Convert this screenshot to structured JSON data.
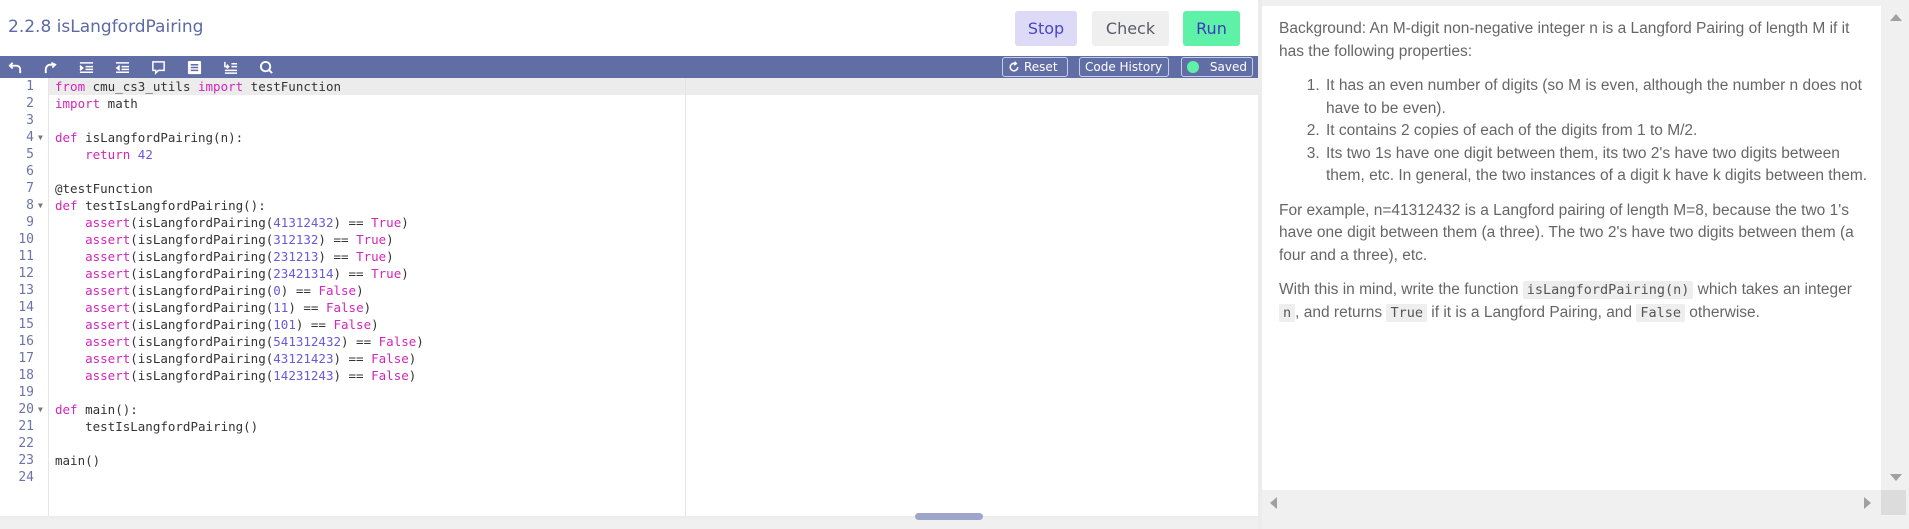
{
  "header": {
    "title": "2.2.8 isLangfordPairing",
    "buttons": {
      "stop": "Stop",
      "check": "Check",
      "run": "Run"
    }
  },
  "toolbar": {
    "icons": [
      "undo-icon",
      "redo-icon",
      "indent-icon",
      "outdent-icon",
      "comment-icon",
      "format-icon",
      "fold-icon",
      "search-icon"
    ],
    "reset_label": "Reset",
    "history_label": "Code History",
    "saved_label": "Saved"
  },
  "editor": {
    "lines": [
      {
        "n": "1",
        "fold": false,
        "tokens": [
          [
            "kw",
            "from"
          ],
          [
            "t",
            " cmu_cs3_utils "
          ],
          [
            "kw",
            "import"
          ],
          [
            "t",
            " testFunction"
          ]
        ]
      },
      {
        "n": "2",
        "fold": false,
        "tokens": [
          [
            "kw",
            "import"
          ],
          [
            "t",
            " math"
          ]
        ]
      },
      {
        "n": "3",
        "fold": false,
        "tokens": []
      },
      {
        "n": "4",
        "fold": true,
        "tokens": [
          [
            "kw",
            "def"
          ],
          [
            "t",
            " isLangfordPairing(n):"
          ]
        ]
      },
      {
        "n": "5",
        "fold": false,
        "tokens": [
          [
            "t",
            "    "
          ],
          [
            "kw",
            "return"
          ],
          [
            "t",
            " "
          ],
          [
            "num",
            "42"
          ]
        ]
      },
      {
        "n": "6",
        "fold": false,
        "tokens": []
      },
      {
        "n": "7",
        "fold": false,
        "tokens": [
          [
            "t",
            "@testFunction"
          ]
        ]
      },
      {
        "n": "8",
        "fold": true,
        "tokens": [
          [
            "kw",
            "def"
          ],
          [
            "t",
            " testIsLangfordPairing():"
          ]
        ]
      },
      {
        "n": "9",
        "fold": false,
        "tokens": [
          [
            "t",
            "    "
          ],
          [
            "kw",
            "assert"
          ],
          [
            "t",
            "(isLangfordPairing("
          ],
          [
            "num",
            "41312432"
          ],
          [
            "t",
            ") == "
          ],
          [
            "bool",
            "True"
          ],
          [
            "t",
            ")"
          ]
        ]
      },
      {
        "n": "10",
        "fold": false,
        "tokens": [
          [
            "t",
            "    "
          ],
          [
            "kw",
            "assert"
          ],
          [
            "t",
            "(isLangfordPairing("
          ],
          [
            "num",
            "312132"
          ],
          [
            "t",
            ") == "
          ],
          [
            "bool",
            "True"
          ],
          [
            "t",
            ")"
          ]
        ]
      },
      {
        "n": "11",
        "fold": false,
        "tokens": [
          [
            "t",
            "    "
          ],
          [
            "kw",
            "assert"
          ],
          [
            "t",
            "(isLangfordPairing("
          ],
          [
            "num",
            "231213"
          ],
          [
            "t",
            ") == "
          ],
          [
            "bool",
            "True"
          ],
          [
            "t",
            ")"
          ]
        ]
      },
      {
        "n": "12",
        "fold": false,
        "tokens": [
          [
            "t",
            "    "
          ],
          [
            "kw",
            "assert"
          ],
          [
            "t",
            "(isLangfordPairing("
          ],
          [
            "num",
            "23421314"
          ],
          [
            "t",
            ") == "
          ],
          [
            "bool",
            "True"
          ],
          [
            "t",
            ")"
          ]
        ]
      },
      {
        "n": "13",
        "fold": false,
        "tokens": [
          [
            "t",
            "    "
          ],
          [
            "kw",
            "assert"
          ],
          [
            "t",
            "(isLangfordPairing("
          ],
          [
            "num",
            "0"
          ],
          [
            "t",
            ") == "
          ],
          [
            "bool",
            "False"
          ],
          [
            "t",
            ")"
          ]
        ]
      },
      {
        "n": "14",
        "fold": false,
        "tokens": [
          [
            "t",
            "    "
          ],
          [
            "kw",
            "assert"
          ],
          [
            "t",
            "(isLangfordPairing("
          ],
          [
            "num",
            "11"
          ],
          [
            "t",
            ") == "
          ],
          [
            "bool",
            "False"
          ],
          [
            "t",
            ")"
          ]
        ]
      },
      {
        "n": "15",
        "fold": false,
        "tokens": [
          [
            "t",
            "    "
          ],
          [
            "kw",
            "assert"
          ],
          [
            "t",
            "(isLangfordPairing("
          ],
          [
            "num",
            "101"
          ],
          [
            "t",
            ") == "
          ],
          [
            "bool",
            "False"
          ],
          [
            "t",
            ")"
          ]
        ]
      },
      {
        "n": "16",
        "fold": false,
        "tokens": [
          [
            "t",
            "    "
          ],
          [
            "kw",
            "assert"
          ],
          [
            "t",
            "(isLangfordPairing("
          ],
          [
            "num",
            "541312432"
          ],
          [
            "t",
            ") == "
          ],
          [
            "bool",
            "False"
          ],
          [
            "t",
            ")"
          ]
        ]
      },
      {
        "n": "17",
        "fold": false,
        "tokens": [
          [
            "t",
            "    "
          ],
          [
            "kw",
            "assert"
          ],
          [
            "t",
            "(isLangfordPairing("
          ],
          [
            "num",
            "43121423"
          ],
          [
            "t",
            ") == "
          ],
          [
            "bool",
            "False"
          ],
          [
            "t",
            ")"
          ]
        ]
      },
      {
        "n": "18",
        "fold": false,
        "tokens": [
          [
            "t",
            "    "
          ],
          [
            "kw",
            "assert"
          ],
          [
            "t",
            "(isLangfordPairing("
          ],
          [
            "num",
            "14231243"
          ],
          [
            "t",
            ") == "
          ],
          [
            "bool",
            "False"
          ],
          [
            "t",
            ")"
          ]
        ]
      },
      {
        "n": "19",
        "fold": false,
        "tokens": []
      },
      {
        "n": "20",
        "fold": true,
        "tokens": [
          [
            "kw",
            "def"
          ],
          [
            "t",
            " main():"
          ]
        ]
      },
      {
        "n": "21",
        "fold": false,
        "tokens": [
          [
            "t",
            "    testIsLangfordPairing()"
          ]
        ]
      },
      {
        "n": "22",
        "fold": false,
        "tokens": []
      },
      {
        "n": "23",
        "fold": false,
        "tokens": [
          [
            "t",
            "main()"
          ]
        ]
      },
      {
        "n": "24",
        "fold": false,
        "tokens": []
      }
    ]
  },
  "description": {
    "intro": "Background: An M-digit non-negative integer n is a Langford Pairing of length M if it has the following properties:",
    "properties": [
      "It has an even number of digits (so M is even, although the number n does not have to be even).",
      "It contains 2 copies of each of the digits from 1 to M/2.",
      "Its two 1s have one digit between them, its two 2's have two digits between them, etc. In general, the two instances of a digit k have k digits between them."
    ],
    "example": "For example, n=41312432 is a Langford pairing of length M=8, because the two 1's have one digit between them (a three). The two 2's have two digits between them (a four and a three), etc.",
    "task": {
      "part1": "With this in mind, write the function ",
      "code1": "isLangfordPairing(n)",
      "part2": " which takes an integer ",
      "code2": "n",
      "part3": ", and returns ",
      "code3": "True",
      "part4": " if it is a Langford Pairing, and ",
      "code4": "False",
      "part5": " otherwise."
    }
  },
  "colors": {
    "toolbar": "#616ea6",
    "title": "#5d6aa6",
    "stop_bg": "#dcdaf7",
    "check_bg": "#efefef",
    "run_bg": "#5ef2a8",
    "keyword": "#d126b8",
    "number": "#6a5ad6"
  }
}
